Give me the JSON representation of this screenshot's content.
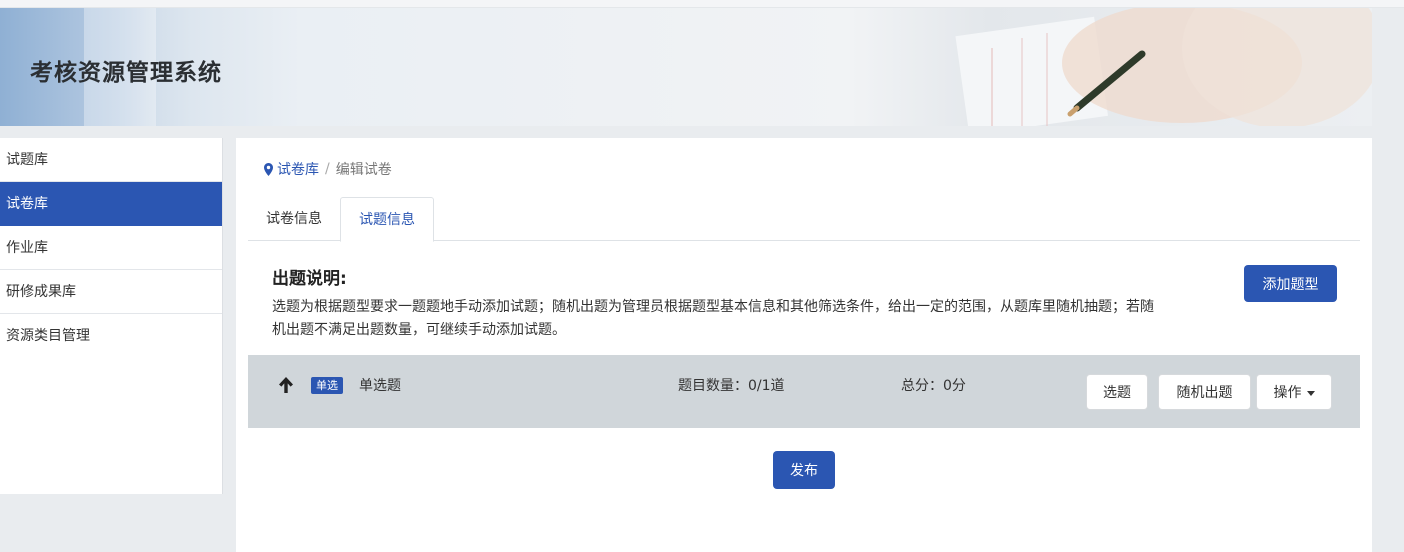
{
  "app": {
    "title": "考核资源管理系统"
  },
  "sidebar": {
    "items": [
      {
        "label": "试题库"
      },
      {
        "label": "试卷库"
      },
      {
        "label": "作业库"
      },
      {
        "label": "研修成果库"
      },
      {
        "label": "资源类目管理"
      }
    ],
    "active_index": 1
  },
  "breadcrumb": {
    "link": "试卷库",
    "separator": "/",
    "current": "编辑试卷"
  },
  "tabs": [
    {
      "label": "试卷信息"
    },
    {
      "label": "试题信息"
    }
  ],
  "instructions": {
    "title": "出题说明:",
    "text": "选题为根据题型要求一题题地手动添加试题；随机出题为管理员根据题型基本信息和其他筛选条件，给出一定的范围，从题库里随机抽题；若随机出题不满足出题数量，可继续手动添加试题。",
    "add_button": "添加题型"
  },
  "question_type": {
    "badge": "单选",
    "name": "单选题",
    "count_text": "题目数量：0/1道",
    "score_text": "总分：0分",
    "select_button": "选题",
    "random_button": "随机出题",
    "ops_button": "操作"
  },
  "publish_button": "发布",
  "colors": {
    "primary": "#2b56b2",
    "type_bar": "#d0d6da"
  },
  "icons": {
    "breadcrumb": "map-marker-icon",
    "sort": "arrow-up-icon",
    "dropdown": "caret-down-icon"
  }
}
